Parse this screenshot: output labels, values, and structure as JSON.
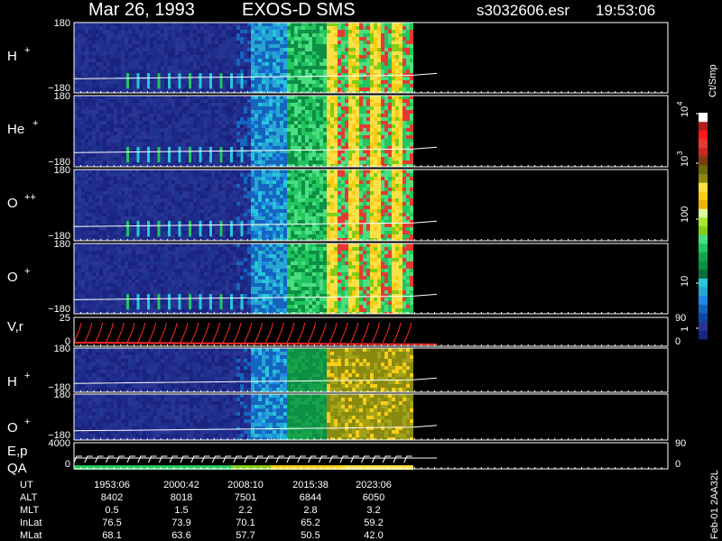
{
  "header": {
    "date": "Mar 26, 1993",
    "instrument": "EXOS-D SMS",
    "file": "s3032606.esr",
    "time": "19:53:06"
  },
  "colorbar": {
    "label": "Ct/Smp",
    "ticks": [
      "1",
      "10",
      "100",
      "10",
      "10"
    ],
    "tick_sups": [
      "",
      "",
      "",
      "3",
      "4"
    ],
    "colors": [
      "#1a237e",
      "#283593",
      "#0d47a1",
      "#1565c0",
      "#1e88e5",
      "#26a6d1",
      "#26c6da",
      "#0a6e3c",
      "#0d8f45",
      "#16a34a",
      "#22c55e",
      "#4ade80",
      "#84cc16",
      "#a3e635",
      "#d9f99d",
      "#eab308",
      "#facc15",
      "#fde047",
      "#8a8a10",
      "#6b6b0a",
      "#7a3c0a",
      "#c62828",
      "#e53935",
      "#ff1a1a",
      "#b71c1c",
      "#ffffff"
    ]
  },
  "panels": [
    {
      "label": "H",
      "sup": "+",
      "ytop": "180",
      "ybot": "−180",
      "type": "spec",
      "cols": 300
    },
    {
      "label": "He",
      "sup": "+",
      "ytop": "180",
      "ybot": "−180",
      "type": "spec",
      "cols": 300
    },
    {
      "label": "O",
      "sup": "++",
      "ytop": "180",
      "ybot": "−180",
      "type": "spec",
      "cols": 300
    },
    {
      "label": "O",
      "sup": "+",
      "ytop": "180",
      "ybot": "−180",
      "type": "spec",
      "cols": 300
    },
    {
      "label": "V,r",
      "sup": "",
      "ytop": "25",
      "ybot": "0",
      "rtop": "90",
      "rbot": "0",
      "type": "line"
    },
    {
      "label": "H",
      "sup": "+",
      "ytop": "180",
      "ybot": "−180",
      "type": "spec2",
      "cols": 300
    },
    {
      "label": "O",
      "sup": "+",
      "ytop": "180",
      "ybot": "−180",
      "type": "spec2",
      "cols": 300
    },
    {
      "label": "E,p",
      "label2": "QA",
      "sup": "",
      "ytop": "4000",
      "ybot": "0",
      "rtop": "90",
      "rbot": "0",
      "type": "line2"
    }
  ],
  "side_text": "Feb-01 2AA32L",
  "ephemeris": {
    "rows": [
      {
        "name": "UT",
        "values": [
          "1953:06",
          "2000:42",
          "2008:10",
          "2015:38",
          "2023:06"
        ]
      },
      {
        "name": "ALT",
        "values": [
          "8402",
          "8018",
          "7501",
          "6844",
          "6050"
        ]
      },
      {
        "name": "MLT",
        "values": [
          "0.5",
          "1.5",
          "2.2",
          "2.8",
          "3.2"
        ]
      },
      {
        "name": "InLat",
        "values": [
          "76.5",
          "73.9",
          "70.1",
          "65.2",
          "59.2"
        ]
      },
      {
        "name": "MLat",
        "values": [
          "68.1",
          "63.6",
          "57.7",
          "50.5",
          "42.0"
        ]
      }
    ]
  },
  "chart_data": {
    "type": "heatmap",
    "title": "Mar 26, 1993   EXOS-D SMS",
    "colorbar_label": "Ct/Smp",
    "colorbar_range": [
      1,
      10000
    ],
    "time_labels": [
      "1953:06",
      "2000:42",
      "2008:10",
      "2015:38",
      "2023:06"
    ],
    "species": [
      "H+",
      "He+",
      "O++",
      "O+",
      "V,r",
      "H+",
      "O+",
      "E,p QA"
    ]
  }
}
